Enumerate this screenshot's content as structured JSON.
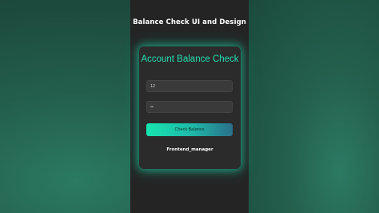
{
  "page": {
    "title": "Balance Check UI and Design"
  },
  "card": {
    "title": "Account Balance Check",
    "account_field": {
      "value": "12",
      "placeholder": ""
    },
    "pin_field": {
      "value": "••",
      "placeholder": ""
    },
    "check_button_label": "Check Balance",
    "credit": "Frontend_manager"
  },
  "colors": {
    "accent": "#22e0b1",
    "card_background": "#2b2b2b",
    "frame_background": "#242424",
    "button_gradient_start": "#16e6b0",
    "button_gradient_end": "#2a6f8a"
  }
}
